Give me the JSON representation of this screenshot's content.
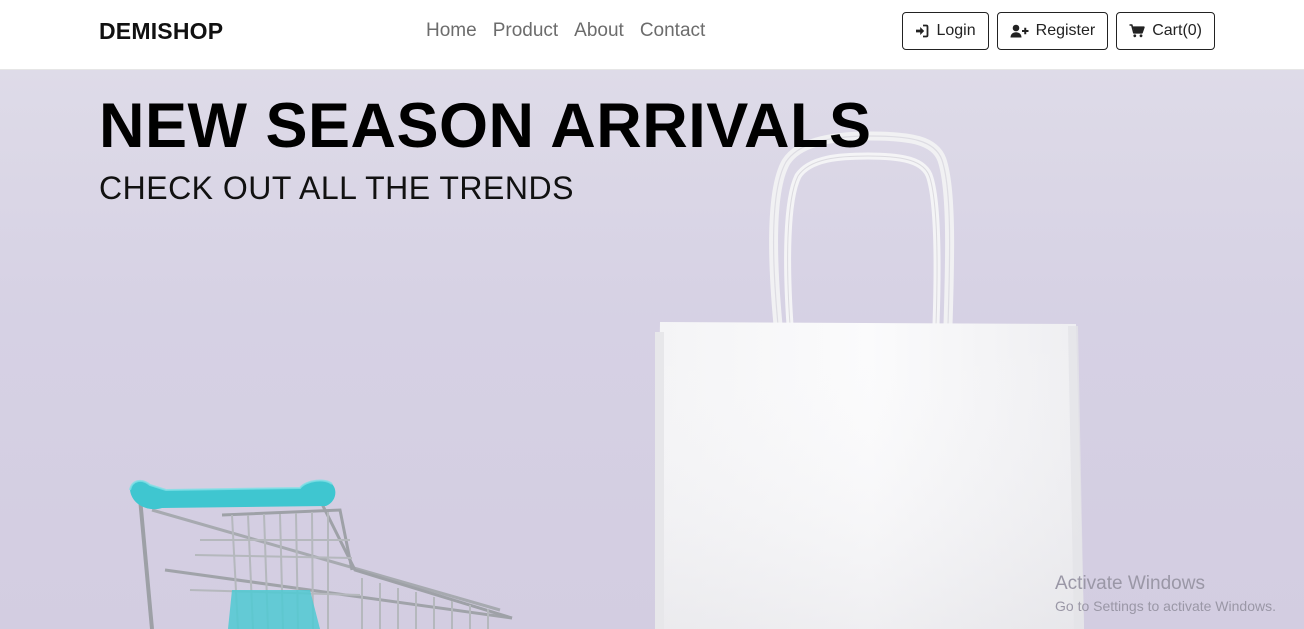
{
  "navbar": {
    "brand": "DEMISHOP",
    "links": [
      "Home",
      "Product",
      "About",
      "Contact"
    ],
    "buttons": {
      "login": "Login",
      "register": "Register",
      "cart": "Cart(0)"
    }
  },
  "hero": {
    "title": "NEW SEASON ARRIVALS",
    "subtitle": "CHECK OUT ALL THE TRENDS",
    "background_color": "#d6d1e4",
    "cart_accent_color": "#3fc6d0"
  },
  "watermark": {
    "title": "Activate Windows",
    "subtitle": "Go to Settings to activate Windows."
  }
}
